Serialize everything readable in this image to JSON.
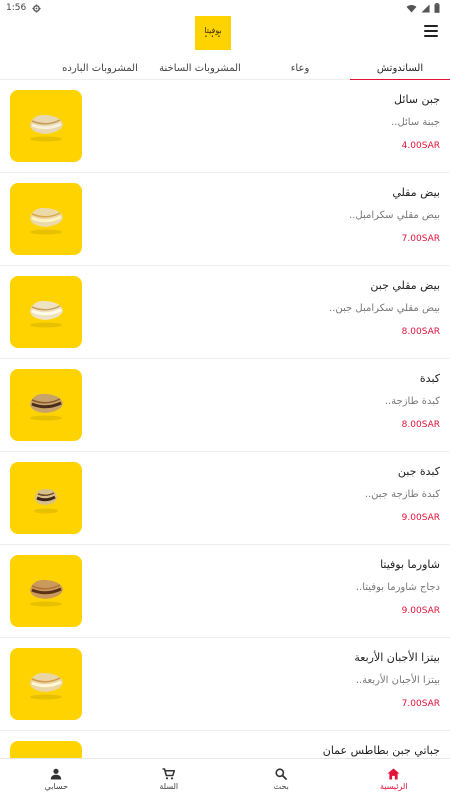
{
  "status": {
    "time": "1:56"
  },
  "colors": {
    "brand_yellow": "#FFD300",
    "accent_red": "#E3123A"
  },
  "header": {
    "logo_text": "بوفيتا",
    "logo_icon": "bofita-logo",
    "menu_icon": "hamburger-menu-icon"
  },
  "tabs": [
    {
      "label": "الساندوتش",
      "active": true
    },
    {
      "label": "وعاء",
      "active": false
    },
    {
      "label": "المشروبات الساخنة",
      "active": false
    },
    {
      "label": "المشروبات البارده",
      "active": false
    }
  ],
  "items": [
    {
      "name": "جبن سائل",
      "desc": "جبنة سائل..",
      "price": "4.00SAR"
    },
    {
      "name": "بيض مقلي",
      "desc": "بيض مقلي سكرامبل..",
      "price": "7.00SAR"
    },
    {
      "name": "بيض مقلي جبن",
      "desc": "بيض مقلي سكرامبل جبن..",
      "price": "8.00SAR"
    },
    {
      "name": "كبدة",
      "desc": "كبدة طازجة..",
      "price": "8.00SAR"
    },
    {
      "name": "كبدة جبن",
      "desc": "كبدة طازجة جبن..",
      "price": "9.00SAR"
    },
    {
      "name": "شاورما بوفيتا",
      "desc": "دجاج شاورما بوفيتا..",
      "price": "9.00SAR"
    },
    {
      "name": "بيتزا الأجبان الأربعة",
      "desc": "بيتزا الأجبان الأربعة..",
      "price": "7.00SAR"
    },
    {
      "name": "جباتي جبن بطاطس عمان",
      "desc": "",
      "price": ""
    }
  ],
  "bottom_nav": [
    {
      "label": "الرئيسية",
      "icon": "home-icon",
      "active": true
    },
    {
      "label": "بحث",
      "icon": "search-icon",
      "active": false
    },
    {
      "label": "السلة",
      "icon": "cart-icon",
      "active": false
    },
    {
      "label": "حسابي",
      "icon": "account-icon",
      "active": false
    }
  ]
}
